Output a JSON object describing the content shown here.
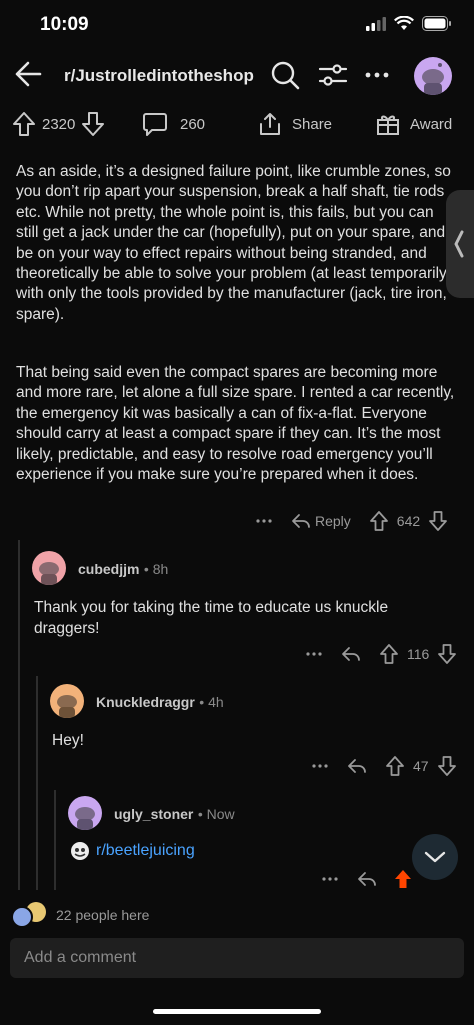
{
  "status": {
    "time": "10:09"
  },
  "header": {
    "subreddit": "r/Justrolledintotheshop"
  },
  "actions": {
    "upvotes": "2320",
    "comments": "260",
    "share": "Share",
    "award": "Award"
  },
  "post": {
    "paragraph1": "As an aside, it’s a designed failure point, like crumble zones, so you don’t rip apart your suspension, break a half shaft, tie rods etc. While not pretty, the whole point is, this fails, but you can still get a jack under the car (hopefully), put on your spare, and be on your way to effect repairs without being stranded, and theoretically be able to solve your problem (at least temporarily) with only the tools provided by the manufacturer (jack, tire iron, spare).",
    "paragraph2": "That being said even the compact spares are becoming more and more rare, let alone a full size spare. I rented a car recently, the emergency kit was basically a can of fix-a-flat. Everyone should carry at least a compact spare if they can. It’s the most likely, predictable, and easy to resolve road emergency you’ll experience if you make sure you’re prepared when it does.",
    "reply_label": "Reply",
    "score": "642"
  },
  "comments": [
    {
      "username": "cubedjjm",
      "time": "8h",
      "text": "Thank you for taking the time to educate us knuckle draggers!",
      "score": "116",
      "avatar_color": "#f0a3a8"
    },
    {
      "username": "Knuckledraggr",
      "time": "4h",
      "text": "Hey!",
      "score": "47",
      "avatar_color": "#f2b27a"
    },
    {
      "username": "ugly_stoner",
      "time": "Now",
      "link": "r/beetlejuicing",
      "avatar_color": "#c9a7f0"
    }
  ],
  "footer": {
    "here": "22 people here",
    "comment_placeholder": "Add a comment"
  },
  "colors": {
    "accent_link": "#4aa3ff",
    "upvote_active": "#ff4500",
    "background": "#0b0b0b"
  }
}
